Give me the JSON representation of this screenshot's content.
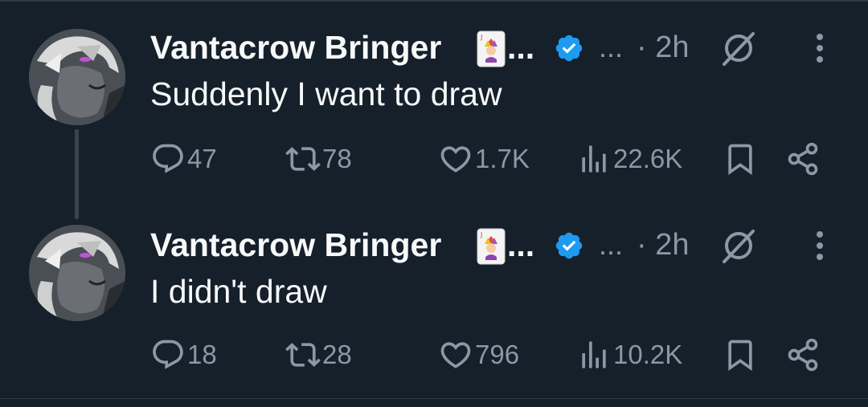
{
  "thread": [
    {
      "author": {
        "display_name": "Vantacrow Bringer",
        "name_truncation": "...",
        "verified": true,
        "handle_truncation": "...",
        "emoji": "joker-card"
      },
      "time": "· 2h",
      "text": "Suddenly I want to draw",
      "actions": {
        "replies": "47",
        "reposts": "78",
        "likes": "1.7K",
        "views": "22.6K"
      }
    },
    {
      "author": {
        "display_name": "Vantacrow Bringer",
        "name_truncation": "...",
        "verified": true,
        "handle_truncation": "...",
        "emoji": "joker-card"
      },
      "time": "· 2h",
      "text": "I didn't draw",
      "actions": {
        "replies": "18",
        "reposts": "28",
        "likes": "796",
        "views": "10.2K"
      }
    }
  ],
  "icons": {
    "reply": "reply-icon",
    "repost": "repost-icon",
    "like": "heart-icon",
    "views": "views-icon",
    "bookmark": "bookmark-icon",
    "share": "share-icon",
    "grok": "grok-icon",
    "more": "more-icon",
    "verified": "verified-badge-icon"
  },
  "colors": {
    "background": "#15202b",
    "primary_text": "#f7f9f9",
    "secondary_text": "#8b98a5",
    "verified_blue": "#1d9bf0",
    "thread_line": "#38444d"
  }
}
